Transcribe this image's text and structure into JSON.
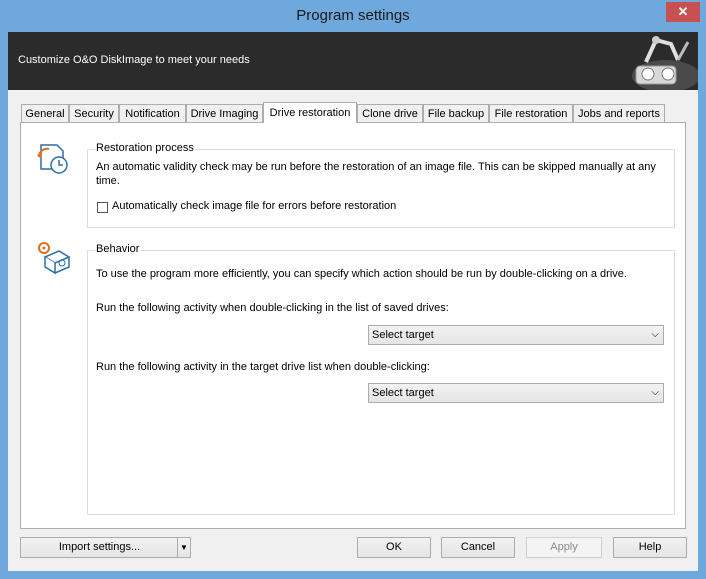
{
  "window": {
    "title": "Program settings",
    "close_glyph": "✕"
  },
  "banner": {
    "text": "Customize O&O DiskImage to meet your needs"
  },
  "tabs": [
    {
      "label": "General"
    },
    {
      "label": "Security"
    },
    {
      "label": "Notification"
    },
    {
      "label": "Drive Imaging"
    },
    {
      "label": "Drive restoration",
      "selected": true
    },
    {
      "label": "Clone drive"
    },
    {
      "label": "File backup"
    },
    {
      "label": "File restoration"
    },
    {
      "label": "Jobs and reports"
    }
  ],
  "restoration": {
    "title": "Restoration process",
    "description": "An automatic validity check may be run before the restoration of an image file. This can be skipped manually at any time.",
    "checkbox_label": "Automatically check image file for errors before restoration",
    "checked": false
  },
  "behavior": {
    "title": "Behavior",
    "description": "To use the program more efficiently, you can specify which action should be run by double-clicking on a drive.",
    "saved_label": "Run the following activity when double-clicking in the list of saved drives:",
    "saved_value": "Select target",
    "target_label": "Run the following activity in the target drive list when double-clicking:",
    "target_value": "Select target"
  },
  "buttons": {
    "import": "Import settings...",
    "ok": "OK",
    "cancel": "Cancel",
    "apply": "Apply",
    "help": "Help"
  },
  "colors": {
    "titlebar": "#6fa8dc",
    "banner": "#2b2b2b",
    "close": "#c75050"
  }
}
